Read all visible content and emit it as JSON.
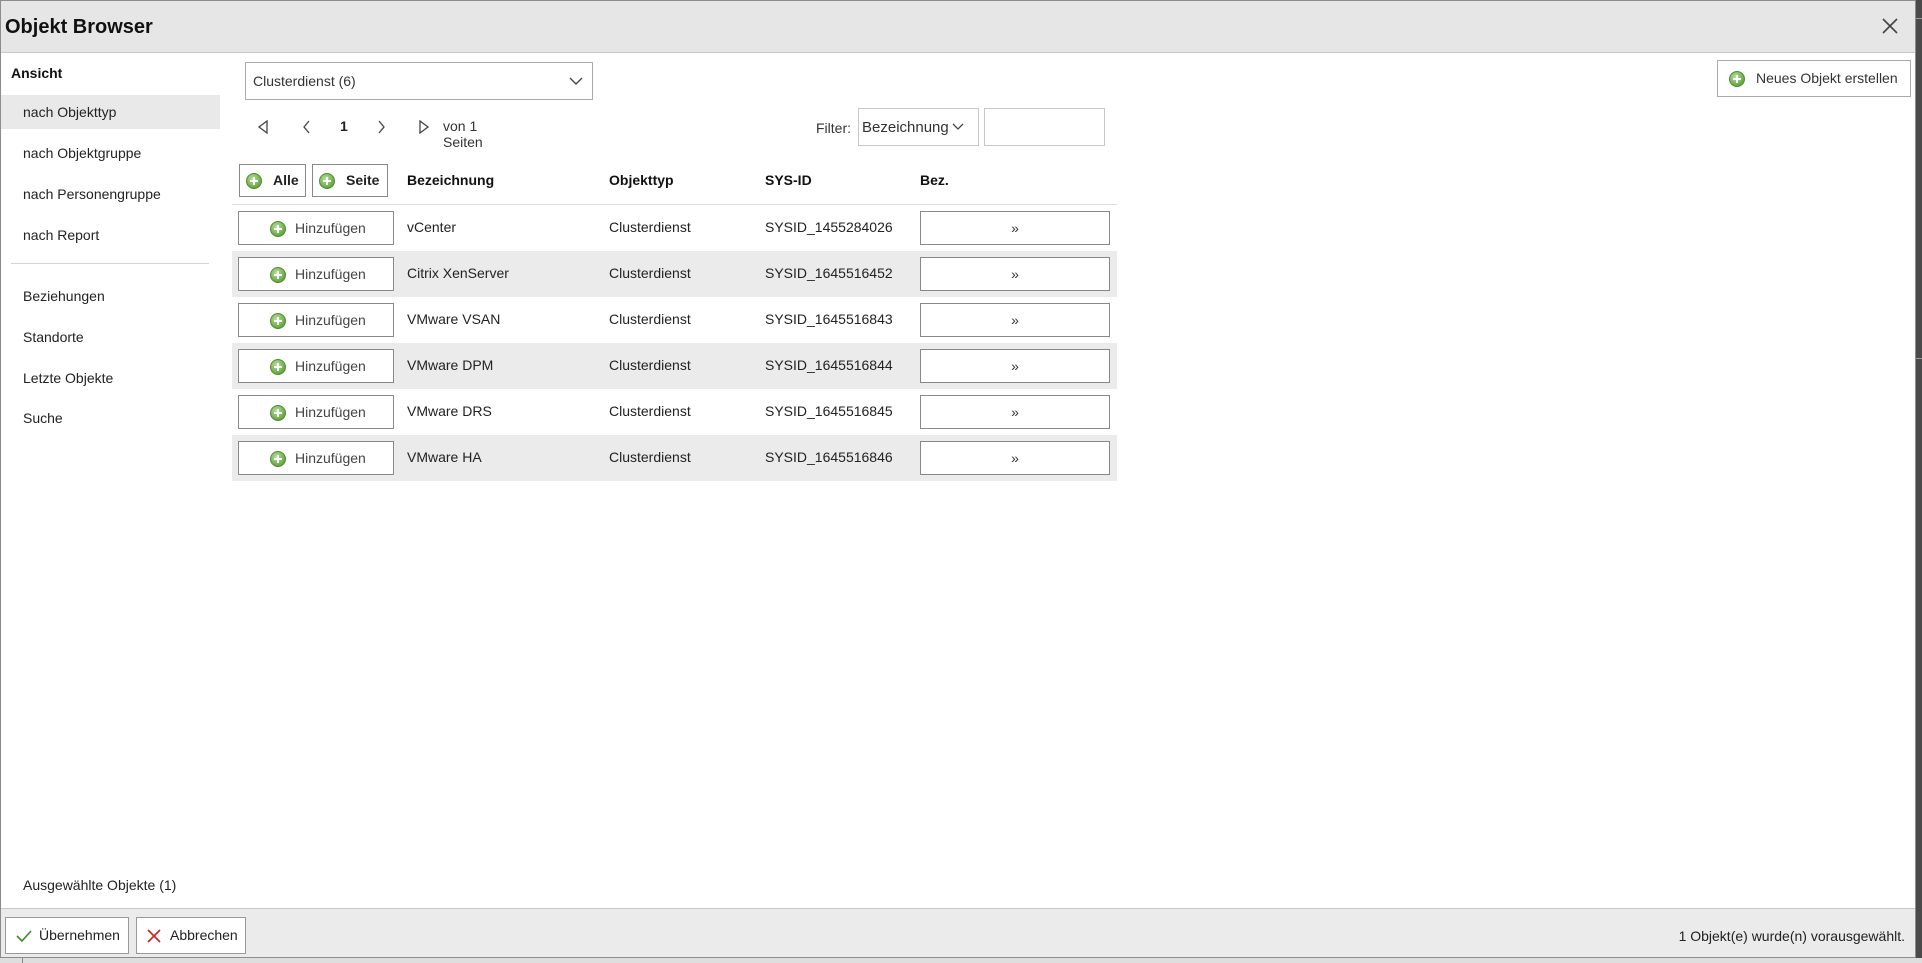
{
  "title": "Objekt Browser",
  "sidebar": {
    "heading": "Ansicht",
    "items": [
      {
        "label": "nach Objekttyp",
        "active": true
      },
      {
        "label": "nach Objektgruppe"
      },
      {
        "label": "nach Personengruppe"
      },
      {
        "label": "nach Report"
      }
    ],
    "items2": [
      {
        "label": "Beziehungen"
      },
      {
        "label": "Standorte"
      },
      {
        "label": "Letzte Objekte"
      },
      {
        "label": "Suche"
      }
    ],
    "selected_objects": "Ausgewählte Objekte (1)"
  },
  "type_select": {
    "value": "Clusterdienst (6)"
  },
  "pager": {
    "current_page": "1",
    "pages_text": "von 1 Seiten"
  },
  "filter": {
    "label": "Filter:",
    "field": "Bezeichnung",
    "value": ""
  },
  "new_object_label": "Neues Objekt erstellen",
  "table": {
    "btn_all": "Alle",
    "btn_page": "Seite",
    "columns": [
      "Bezeichnung",
      "Objekttyp",
      "SYS-ID",
      "Bez."
    ],
    "add_label": "Hinzufügen",
    "rel_label": "»",
    "rows": [
      {
        "name": "vCenter",
        "type": "Clusterdienst",
        "sysid": "SYSID_1455284026"
      },
      {
        "name": "Citrix XenServer",
        "type": "Clusterdienst",
        "sysid": "SYSID_1645516452"
      },
      {
        "name": "VMware VSAN",
        "type": "Clusterdienst",
        "sysid": "SYSID_1645516843"
      },
      {
        "name": "VMware DPM",
        "type": "Clusterdienst",
        "sysid": "SYSID_1645516844"
      },
      {
        "name": "VMware DRS",
        "type": "Clusterdienst",
        "sysid": "SYSID_1645516845"
      },
      {
        "name": "VMware HA",
        "type": "Clusterdienst",
        "sysid": "SYSID_1645516846"
      }
    ]
  },
  "footer": {
    "apply_label": "Übernehmen",
    "cancel_label": "Abbrechen",
    "status": "1 Objekt(e) wurde(n) vorausgewählt."
  },
  "icons": {
    "close": "close-icon",
    "chevron": "chevron-down-icon",
    "first": "first-page-icon",
    "prev": "prev-page-icon",
    "next": "next-page-icon",
    "last": "last-page-icon",
    "plus": "plus-circle-icon",
    "check": "check-icon",
    "cancel": "x-icon"
  },
  "colors": {
    "accent_green": "#72b14f",
    "cancel_red": "#cc2222",
    "row_alt": "#ebebeb"
  }
}
